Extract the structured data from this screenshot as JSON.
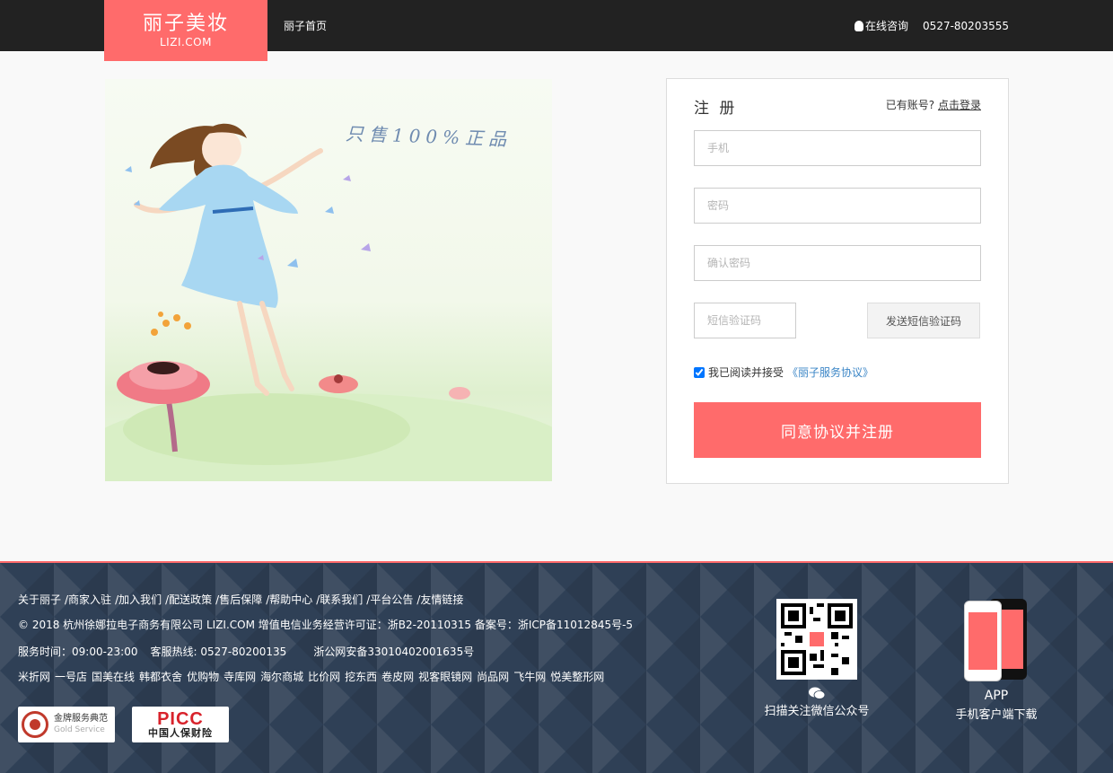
{
  "header": {
    "logo_cn": "丽子美妆",
    "logo_en": "LIZI.COM",
    "home_link": "丽子首页",
    "online_consult": "在线咨询",
    "phone": "0527-80203555"
  },
  "hero": {
    "tagline": "只售100%正品"
  },
  "register": {
    "title": "注 册",
    "have_account_prefix": "已有账号?",
    "login_link": "点击登录",
    "phone_placeholder": "手机",
    "password_placeholder": "密码",
    "confirm_placeholder": "确认密码",
    "sms_placeholder": "短信验证码",
    "sms_button": "发送短信验证码",
    "agree_text": "我已阅读并接受",
    "agree_checked": true,
    "terms_link": "《丽子服务协议》",
    "submit_label": "同意协议并注册"
  },
  "footer": {
    "links": [
      "关于丽子",
      "/商家入驻",
      "/加入我们",
      "/配送政策",
      "/售后保障",
      "/帮助中心",
      "/联系我们",
      "/平台公告",
      "/友情链接"
    ],
    "copyright": "© 2018 杭州徐娜拉电子商务有限公司 LIZI.COM 增值电信业务经营许可证：浙B2-20110315 备案号：浙ICP备11012845号-5",
    "service_hours": "服务时间：09:00-23:00",
    "hotline": "客服热线: 0527-80200135",
    "police_record": "浙公网安备33010402001635号",
    "partner_sites": [
      "米折网",
      "一号店",
      "国美在线",
      "韩都衣舍",
      "优购物",
      "寺库网",
      "海尔商城",
      "比价网",
      "挖东西",
      "卷皮网",
      "视客眼镜网",
      "尚品网",
      "飞牛网",
      "悦美整形网"
    ],
    "gold_badge_cn": "金牌服务典范",
    "gold_badge_en": "Gold Service",
    "picc_logo": "PICC",
    "picc_sub": "中国人保财险",
    "qr_caption": "扫描关注微信公众号",
    "app_title": "APP",
    "app_caption": "手机客户端下载"
  },
  "colors": {
    "brand": "#ff6b6b",
    "header_bg": "#222222",
    "footer_bg": "#2f4056",
    "link_blue": "#3a85c6"
  }
}
